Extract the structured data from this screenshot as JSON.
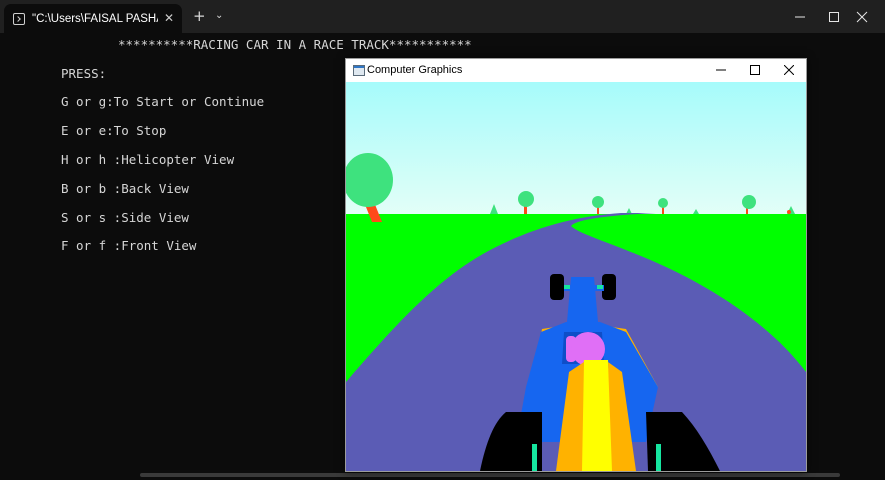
{
  "terminal": {
    "tab_title": "\"C:\\Users\\FAISAL PASHA\\Doc",
    "close_glyph": "✕",
    "new_tab_glyph": "+",
    "dropdown_glyph": "⌄",
    "heading": "**********RACING CAR IN A RACE TRACK***********",
    "lines": [
      "PRESS:",
      "G or g:To Start or Continue",
      "E or e:To Stop",
      "H or h :Helicopter View",
      "B or b :Back View",
      "S or s :Side View",
      "F or f :Front View"
    ]
  },
  "graphics_window": {
    "title": "Computer Graphics",
    "colors": {
      "sky": "#a6fbfb",
      "grass": "#00ff00",
      "road": "#5b5cb5",
      "car_body": "#1666f0",
      "car_side": "#ffb200",
      "car_stripe": "#ffff00",
      "helmet": "#e06ff6",
      "tire": "#000000",
      "tree_foliage": "#3ee27e",
      "tree_trunk": "#ff4a1a"
    }
  }
}
